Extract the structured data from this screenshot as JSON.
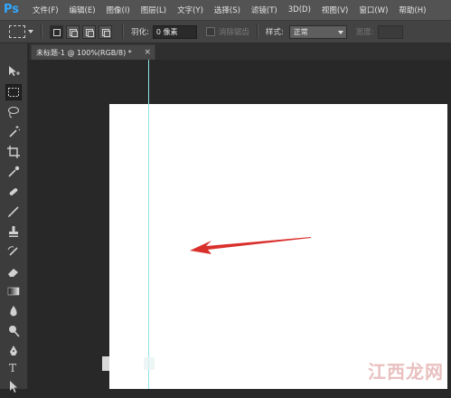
{
  "app": {
    "logo_text": "Ps"
  },
  "menu": [
    "文件(F)",
    "编辑(E)",
    "图像(I)",
    "图层(L)",
    "文字(Y)",
    "选择(S)",
    "滤镜(T)",
    "3D(D)",
    "视图(V)",
    "窗口(W)",
    "帮助(H)"
  ],
  "options": {
    "feather_label": "羽化:",
    "feather_value": "0 像素",
    "antialias_label": "消除锯齿",
    "style_label": "样式:",
    "style_value": "正常",
    "width_label": "宽度:"
  },
  "document": {
    "tab_title": "未标题-1 @ 100%(RGB/8) *",
    "close_glyph": "×"
  },
  "toolbar": {
    "type_tool_glyph": "T"
  },
  "annotation": {
    "arrow_color": "#d9302c"
  },
  "watermark": {
    "text": "江西龙网"
  },
  "colors": {
    "menubar": "#535353",
    "options_bar": "#434343",
    "toolbar": "#3c3c3c",
    "workspace": "#282828",
    "guide": "#8be3ea",
    "canvas": "#ffffff",
    "logo": "#31a8ff"
  }
}
